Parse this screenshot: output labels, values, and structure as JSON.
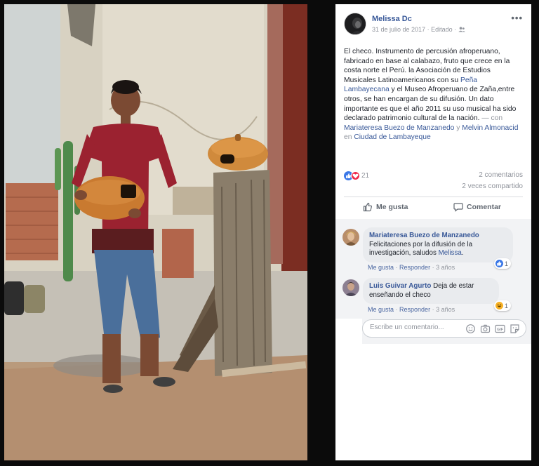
{
  "post": {
    "author": "Melissa Dc",
    "date": "31 de julio de 2017",
    "edited": "Editado",
    "more_icon": "more-horizontal-icon",
    "text": {
      "p1": "El checo. Instrumento de percusión afroperuano, fabricado en base al calabazo, fruto que crece en la costa norte el Perú. la Asociación de Estudios Musicales Latinoamericanos con su ",
      "link_pena": "Peña Lambayecana",
      "p2": " y el Museo Afroperuano de Zaña,entre otros, se han encargan de su difusión. Un dato importante es que el año 2011 su uso musical ha sido declarado patrimonio cultural de la nación.",
      "with": " — con ",
      "tag1": "Mariateresa Buezo de Manzanedo",
      "and": " y ",
      "tag2": "Melvin Almonacid",
      "in": " en ",
      "place": "Ciudad de Lambayeque"
    },
    "reaction_count": "21",
    "comments_count": "2 comentarios",
    "shares_count": "2 veces compartido",
    "like_label": "Me gusta",
    "comment_label": "Comentar"
  },
  "comments": [
    {
      "name": "Mariateresa Buezo de Manzanedo",
      "text": "Felicitaciones por la difusión de la investigación, saludos ",
      "mention": "Melissa",
      "end": ".",
      "like": "Me gusta",
      "reply": "Responder",
      "time": "3 años",
      "reaction": "1"
    },
    {
      "name": "Luis Guivar Agurto",
      "text": " Deja de estar enseñando el checo",
      "like": "Me gusta",
      "reply": "Responder",
      "time": "3 años",
      "reaction": "1"
    }
  ],
  "composer": {
    "placeholder": "Escribe un comentario..."
  },
  "colors": {
    "link": "#385898",
    "like_blue": "#3b78e7",
    "love_red": "#f0284a",
    "muted": "#90949c"
  }
}
